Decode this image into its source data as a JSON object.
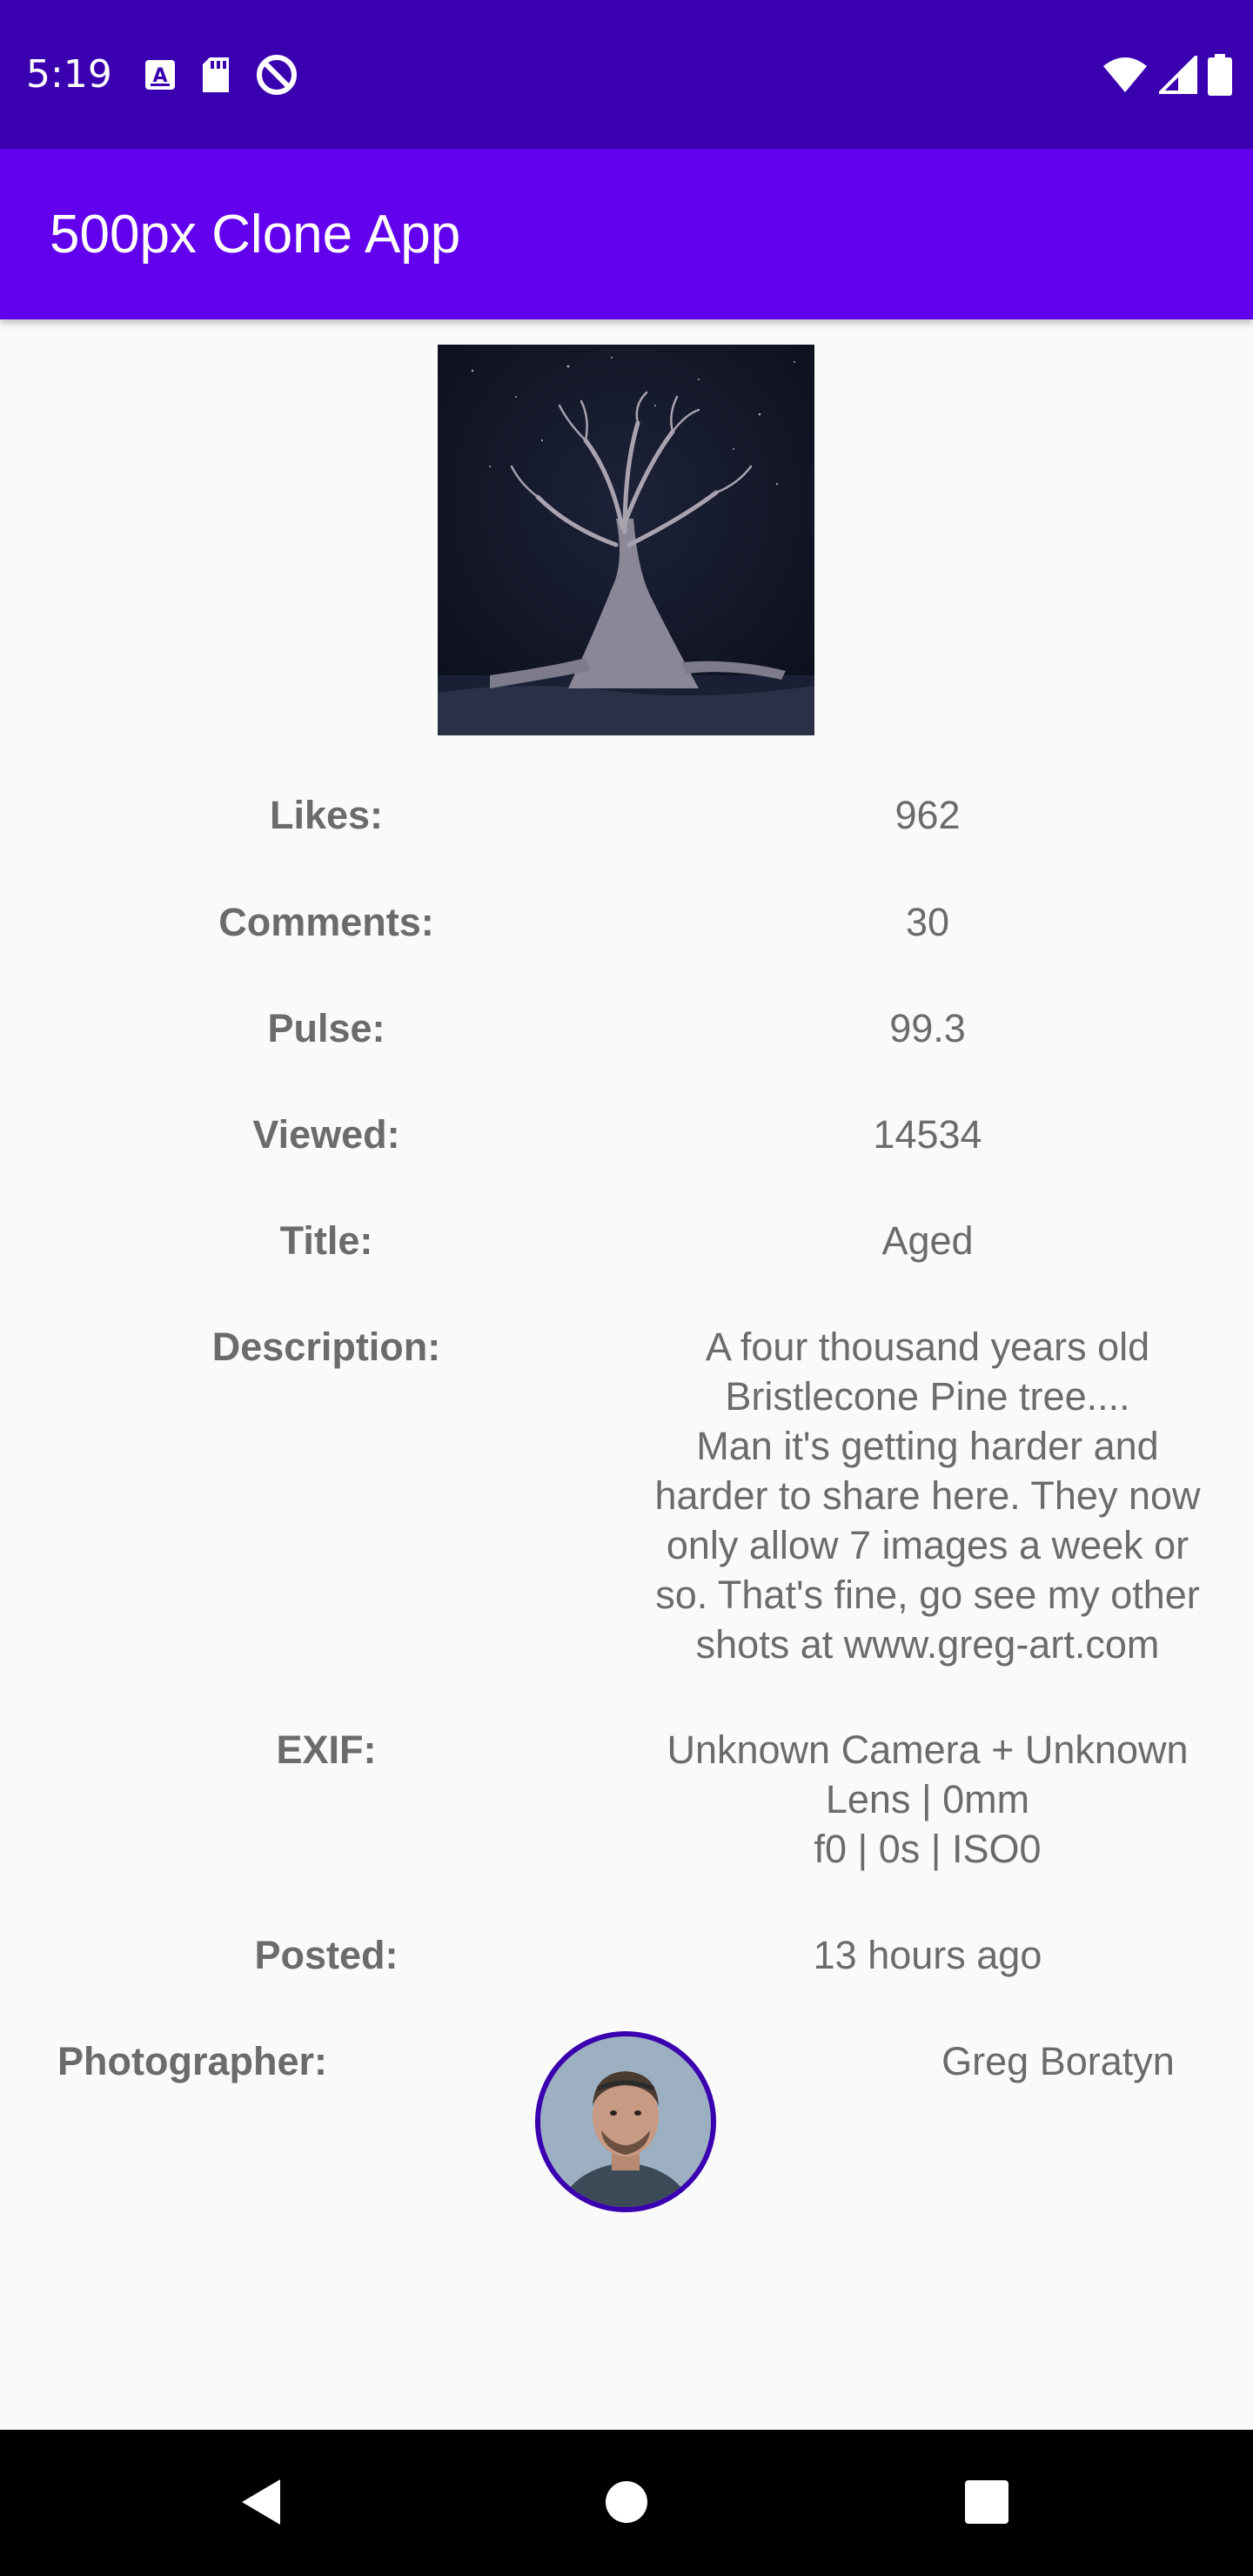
{
  "status_bar": {
    "time": "5:19",
    "left_icons": [
      "a-notification-icon",
      "sd-card-icon",
      "do-not-disturb-icon"
    ],
    "right_icons": [
      "wifi-icon",
      "signal-icon",
      "battery-icon"
    ],
    "background": "#3a00b0"
  },
  "app_bar": {
    "title": "500px Clone App",
    "background": "#6200ee"
  },
  "photo": {
    "subject": "tree-photo"
  },
  "details": {
    "likes": {
      "label": "Likes:",
      "value": "962"
    },
    "comments": {
      "label": "Comments:",
      "value": "30"
    },
    "pulse": {
      "label": "Pulse:",
      "value": "99.3"
    },
    "viewed": {
      "label": "Viewed:",
      "value": "14534"
    },
    "title": {
      "label": "Title:",
      "value": "Aged"
    },
    "description": {
      "label": "Description:",
      "value": "A four thousand years old\nBristlecone Pine tree....\nMan it's getting harder and\nharder to share here. They now\nonly allow 7 images a week or\nso. That's fine, go see my other\nshots at www.greg-art.com"
    },
    "exif": {
      "label": "EXIF:",
      "value": "Unknown Camera + Unknown\nLens | 0mm\nf0 | 0s | ISO0"
    },
    "posted": {
      "label": "Posted:",
      "value": "13 hours ago"
    },
    "photographer": {
      "label": "Photographer:",
      "name": "Greg Boratyn"
    }
  },
  "nav_bar": {
    "buttons": [
      "back-icon",
      "home-icon",
      "recents-icon"
    ]
  }
}
